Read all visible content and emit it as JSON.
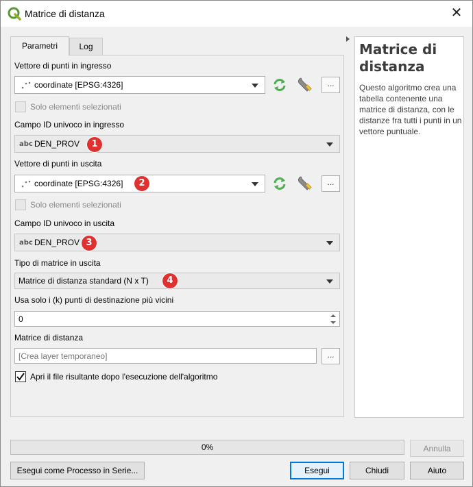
{
  "window": {
    "title": "Matrice di distanza",
    "close_glyph": "✕"
  },
  "tabs": [
    {
      "label": "Parametri"
    },
    {
      "label": "Log"
    }
  ],
  "params": {
    "input_layer": {
      "label": "Vettore di punti in ingresso",
      "value": "coordinate [EPSG:4326]",
      "selected_only": "Solo elementi selezionati"
    },
    "input_field": {
      "label": "Campo ID univoco in ingresso",
      "value": "DEN_PROV",
      "type_icon": "abc"
    },
    "target_layer": {
      "label": "Vettore di punti in uscita",
      "value": "coordinate [EPSG:4326]",
      "selected_only": "Solo elementi selezionati"
    },
    "target_field": {
      "label": "Campo ID univoco in uscita",
      "value": "DEN_PROV",
      "type_icon": "abc"
    },
    "matrix_type": {
      "label": "Tipo di matrice in uscita",
      "value": "Matrice di distanza standard (N x T)"
    },
    "nearest_k": {
      "label": "Usa solo i (k) punti di destinazione più vicini",
      "value": "0"
    },
    "output": {
      "label": "Matrice di distanza",
      "placeholder": "[Crea layer temporaneo]"
    },
    "open_after": {
      "label": "Apri il file risultante dopo l'esecuzione dell'algoritmo",
      "checked": true
    },
    "dots_label": "..."
  },
  "badges": [
    "1",
    "2",
    "3",
    "4"
  ],
  "help": {
    "title": "Matrice di distanza",
    "text": "Questo algoritmo crea una tabella contenente una matrice di distanza, con le distanze fra tutti i punti in un vettore puntuale."
  },
  "progress": {
    "percent": 0,
    "text": "0%"
  },
  "buttons": {
    "cancel": "Annulla",
    "batch": "Esegui come Processo in Serie...",
    "run": "Esegui",
    "close": "Chiudi",
    "help": "Aiuto"
  },
  "colors": {
    "badge": "#e03131",
    "accent": "#0078d7",
    "refresh_icon": "#4caf50"
  },
  "icons": [
    "qgis-logo-icon",
    "close-icon",
    "point-layer-icon",
    "refresh-icon",
    "wrench-icon",
    "chevron-down-icon",
    "spin-up-icon",
    "spin-down-icon",
    "check-icon"
  ]
}
